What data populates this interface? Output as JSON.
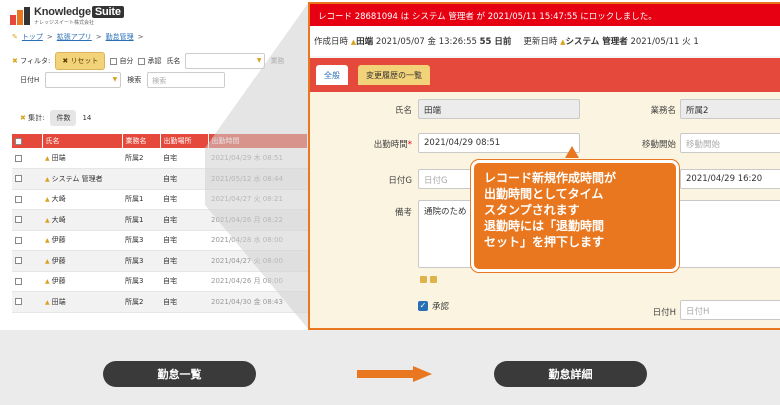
{
  "app": {
    "logo_text": "Knowledge",
    "logo_suite": "Suite",
    "logo_sub": "ナレッジスイート株式会社"
  },
  "breadcrumb": [
    "トップ",
    ">",
    "拡張アプリ",
    ">",
    "勤怠管理",
    ">"
  ],
  "filters": {
    "filter_label": "フィルタ:",
    "reset_label": "リセット",
    "self_label": "自分",
    "approve_label": "承認",
    "name_label": "氏名",
    "dept_label": "業務",
    "date_label": "日付H",
    "search_label": "検索",
    "search_placeholder": "検索"
  },
  "tally": {
    "label": "集計:",
    "count_tab": "件数",
    "count": "14"
  },
  "table": {
    "headers": [
      "",
      "氏名",
      "業務名",
      "出勤場所",
      "出勤時間"
    ],
    "rows": [
      {
        "name": "田端",
        "dept": "所属2",
        "place": "自宅",
        "time": "2021/04/29 木 08:51"
      },
      {
        "name": "システム 管理者",
        "dept": "",
        "place": "自宅",
        "time": "2021/05/12 水 08:44"
      },
      {
        "name": "大崎",
        "dept": "所属1",
        "place": "自宅",
        "time": "2021/04/27 火 08:21"
      },
      {
        "name": "大崎",
        "dept": "所属1",
        "place": "自宅",
        "time": "2021/04/26 月 08:22"
      },
      {
        "name": "伊藤",
        "dept": "所属3",
        "place": "自宅",
        "time": "2021/04/28 水 08:00"
      },
      {
        "name": "伊藤",
        "dept": "所属3",
        "place": "自宅",
        "time": "2021/04/27 火 08:00"
      },
      {
        "name": "伊藤",
        "dept": "所属3",
        "place": "自宅",
        "time": "2021/04/26 月 08:00"
      },
      {
        "name": "田端",
        "dept": "所属2",
        "place": "自宅",
        "time": "2021/04/30 金 08:43"
      }
    ]
  },
  "detail": {
    "alert": "レコード 28681094 は システム 管理者 が 2021/05/11 15:47:55 にロックしました。",
    "created_label": "作成日時",
    "created_user": "田端",
    "created_at": "2021/05/07 金 13:26:55",
    "created_ago": "55 日前",
    "updated_label": "更新日時",
    "updated_user": "システム 管理者",
    "updated_at": "2021/05/11 火 1",
    "tab_general": "全般",
    "tab_history": "変更履歴の一覧",
    "name_label": "氏名",
    "name_value": "田端",
    "dept_label": "業務名",
    "dept_value": "所属2",
    "checkin_label": "出勤時間",
    "required_mark": "*",
    "checkin_value": "2021/04/29 08:51",
    "move_start_label": "移動開始",
    "move_start_placeholder": "移動開始",
    "date_g_label": "日付G",
    "date_g_placeholder": "日付G",
    "date_g_right_value": "2021/04/29 16:20",
    "memo_label": "備考",
    "memo_value": "通院のため",
    "approve_label": "承認",
    "date_h_label": "日付H",
    "date_h_placeholder": "日付H"
  },
  "callout": {
    "lines": [
      "レコード新規作成時間が",
      "出勤時間としてタイム",
      "スタンプされます",
      "退勤時には「退勤時間",
      "セット」を押下します"
    ]
  },
  "flow": {
    "left_label": "勤怠一覧",
    "right_label": "勤怠詳細"
  },
  "colors": {
    "accent_orange": "#e8771f",
    "table_header_red": "#e4493c",
    "alert_red": "#e60012",
    "pill_dark": "#3a3a3a"
  }
}
